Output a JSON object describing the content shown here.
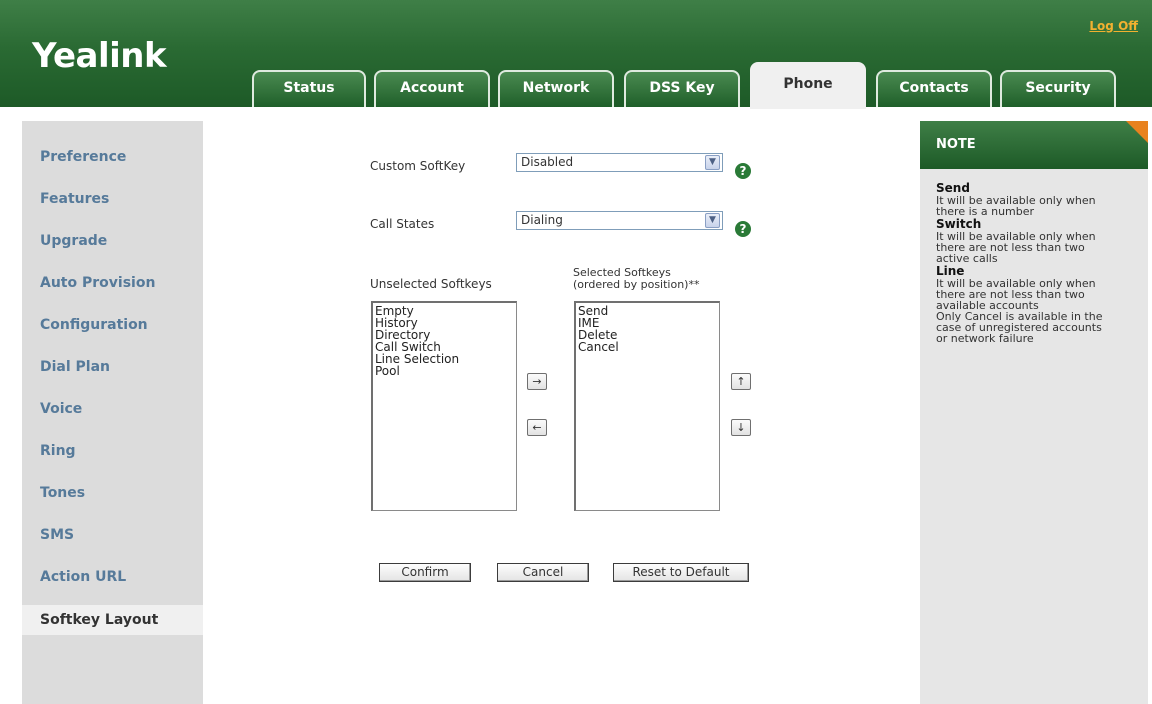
{
  "header": {
    "logo": "Yealink",
    "logoff": "Log Off",
    "tabs": [
      "Status",
      "Account",
      "Network",
      "DSS Key",
      "Phone",
      "Contacts",
      "Security"
    ],
    "active_tab": "Phone"
  },
  "sidebar": {
    "items": [
      "Preference",
      "Features",
      "Upgrade",
      "Auto Provision",
      "Configuration",
      "Dial Plan",
      "Voice",
      "Ring",
      "Tones",
      "SMS",
      "Action URL",
      "Softkey Layout"
    ],
    "active_item": "Softkey Layout"
  },
  "form": {
    "custom_softkey_label": "Custom SoftKey",
    "custom_softkey_value": "Disabled",
    "call_states_label": "Call States",
    "call_states_value": "Dialing",
    "help_glyph": "?",
    "unselected_label": "Unselected Softkeys",
    "selected_label_line1": "Selected Softkeys",
    "selected_label_line2": "(ordered by position)**",
    "unselected_items": [
      "Empty",
      "History",
      "Directory",
      "Call Switch",
      "Line Selection",
      "Pool"
    ],
    "selected_items": [
      "Send",
      "IME",
      "Delete",
      "Cancel"
    ],
    "move_right_glyph": "→",
    "move_left_glyph": "←",
    "move_up_glyph": "↑",
    "move_down_glyph": "↓",
    "confirm_label": "Confirm",
    "cancel_label": "Cancel",
    "reset_label": "Reset to Default"
  },
  "note": {
    "title": "NOTE",
    "sections": [
      {
        "heading": "Send",
        "lines": [
          "It will be available only when",
          "there is a number"
        ]
      },
      {
        "heading": "Switch",
        "lines": [
          "It will be available only when",
          "there are not less than two",
          "active calls"
        ]
      },
      {
        "heading": "Line",
        "lines": [
          "It will be available only when",
          "there are not less than two",
          "available accounts",
          "Only Cancel is available in the",
          "case of unregistered accounts",
          "or network failure"
        ]
      }
    ]
  },
  "colors": {
    "header_green": "#2a6a33",
    "logoff_orange": "#f2b130",
    "sidebar_link": "#567a9a",
    "note_corner": "#e8821f"
  }
}
